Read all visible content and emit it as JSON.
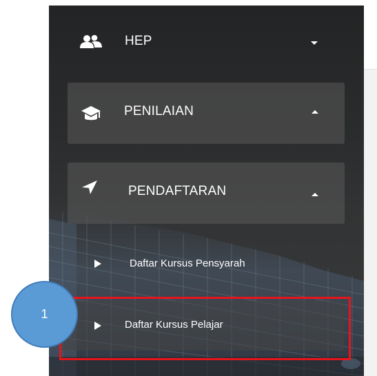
{
  "sidebar": {
    "items": [
      {
        "label": "HEP",
        "icon": "users-icon",
        "state": "collapsed"
      },
      {
        "label": "PENILAIAN",
        "icon": "graduation-cap-icon",
        "state": "expanded"
      },
      {
        "label": "PENDAFTARAN",
        "icon": "location-arrow-icon",
        "state": "expanded"
      }
    ],
    "subitems": [
      {
        "label": "Daftar Kursus Pensyarah",
        "icon": "play-icon"
      },
      {
        "label": "Daftar Kursus Pelajar",
        "icon": "play-icon"
      }
    ]
  },
  "annotation": {
    "step_number": "1",
    "highlight_color": "#e8141b",
    "circle_color": "#5b9bd5"
  },
  "colors": {
    "sidebar_bg": "#2a2b2c",
    "menu_box": "#505050",
    "text": "#ffffff"
  }
}
